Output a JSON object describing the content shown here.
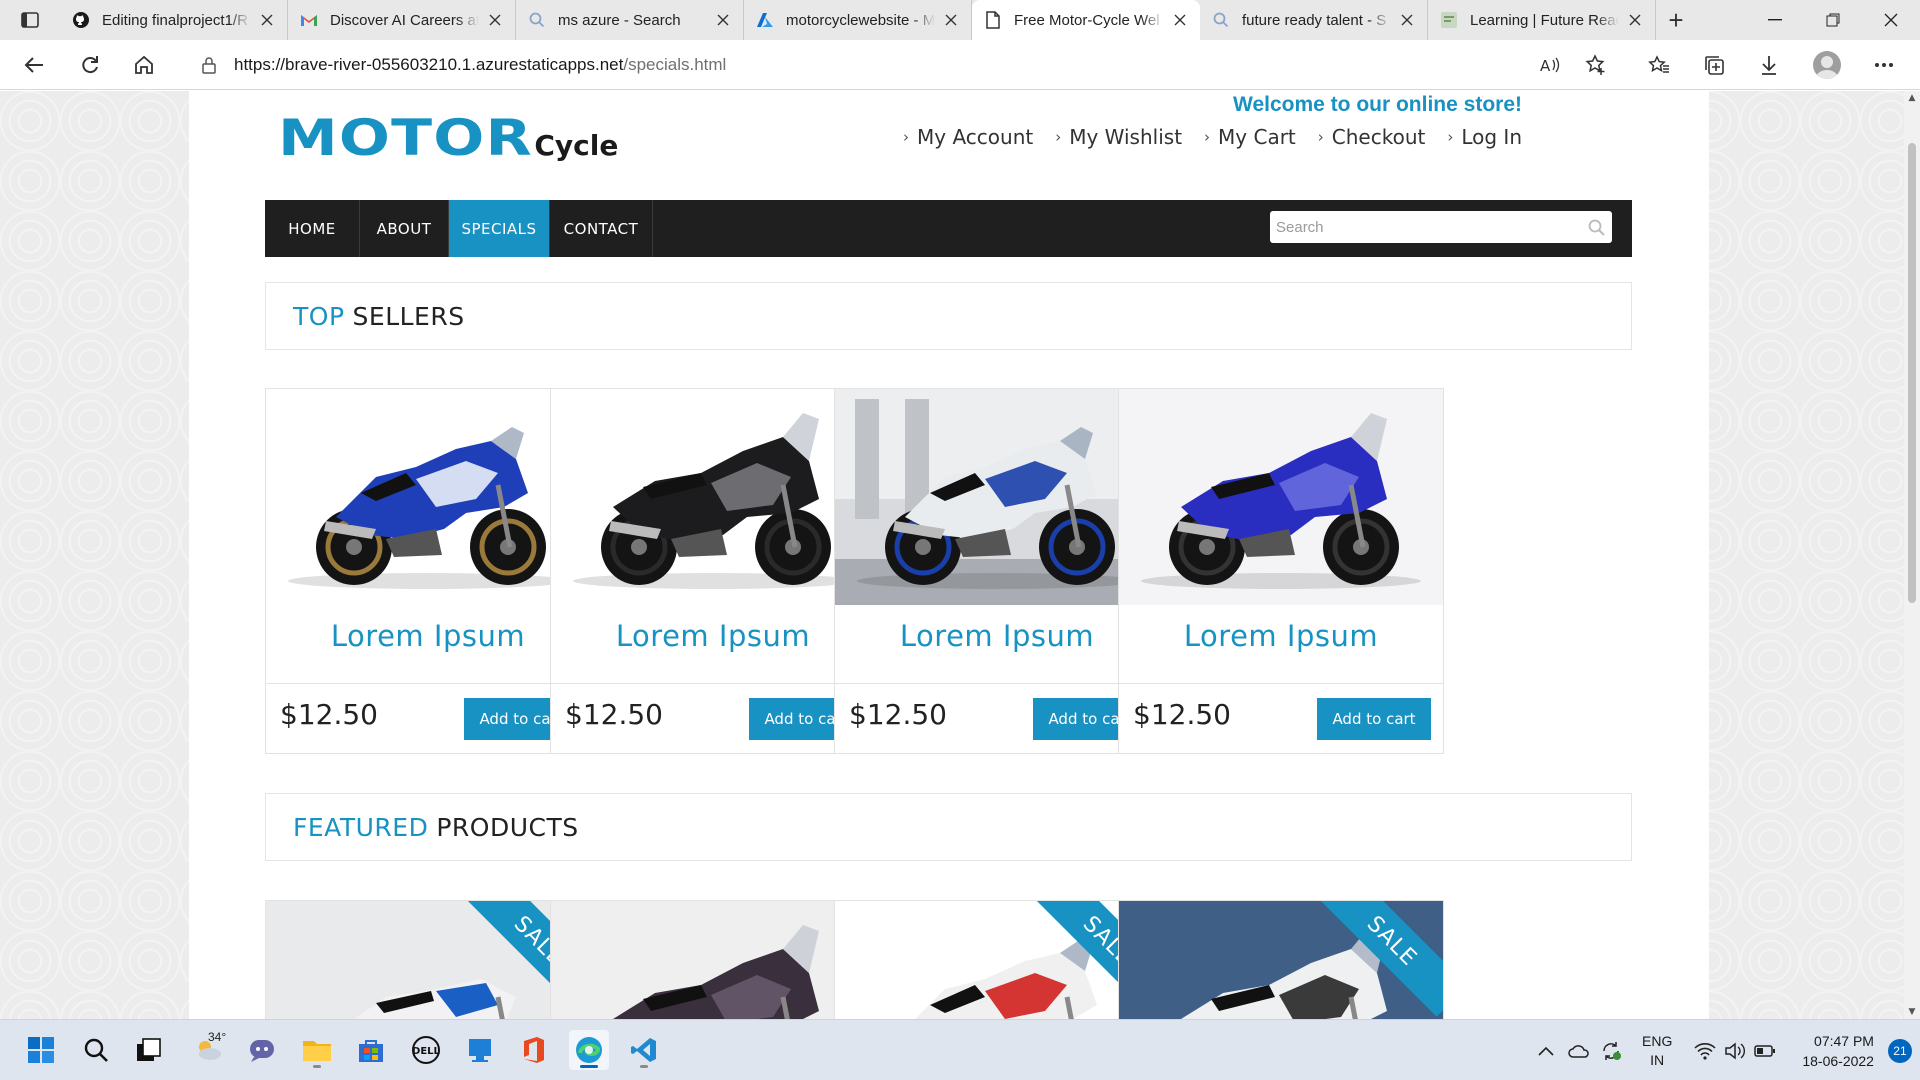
{
  "browser": {
    "tabs": [
      {
        "title": "Editing finalproject1/R",
        "icon": "github-icon"
      },
      {
        "title": "Discover AI Careers at",
        "icon": "gmail-icon"
      },
      {
        "title": "ms azure - Search",
        "icon": "search-icon"
      },
      {
        "title": "motorcyclewebsite - M",
        "icon": "azure-icon"
      },
      {
        "title": "Free Motor-Cycle Wel",
        "icon": "page-icon",
        "active": true
      },
      {
        "title": "future ready talent - S",
        "icon": "search-icon"
      },
      {
        "title": "Learning | Future Read",
        "icon": "learning-icon"
      }
    ],
    "url_host": "https://brave-river-055603210.1.azurestaticapps.net",
    "url_path": "/specials.html"
  },
  "site": {
    "logo_main": "MOTOR",
    "logo_sub": "Cycle",
    "welcome": "Welcome to our online store!",
    "top_links": [
      "My Account",
      "My Wishlist",
      "My Cart",
      "Checkout",
      "Log In"
    ],
    "nav": [
      {
        "label": "HOME"
      },
      {
        "label": "ABOUT"
      },
      {
        "label": "SPECIALS",
        "active": true
      },
      {
        "label": "CONTACT"
      }
    ],
    "search_placeholder": "Search",
    "top_sellers": {
      "accent": "TOP",
      "rest": "SELLERS",
      "products": [
        {
          "name": "Lorem Ipsum",
          "price": "$12.50",
          "button": "Add to cart",
          "image": "blue-sportbike-image"
        },
        {
          "name": "Lorem Ipsum",
          "price": "$12.50",
          "button": "Add to cart",
          "image": "black-touring-bike-image"
        },
        {
          "name": "Lorem Ipsum",
          "price": "$12.50",
          "button": "Add to cart",
          "image": "white-bmw-sportbike-image"
        },
        {
          "name": "Lorem Ipsum",
          "price": "$12.50",
          "button": "Add to cart",
          "image": "blue-touring-bike-image"
        }
      ]
    },
    "featured": {
      "accent": "FEATURED",
      "rest": "PRODUCTS",
      "products": [
        {
          "sale": "SALE",
          "image": "white-blue-naked-bike-image"
        },
        {
          "sale": "",
          "image": "dark-purple-sport-tourer-image"
        },
        {
          "sale": "SALE",
          "image": "red-white-sportbike-image"
        },
        {
          "sale": "SALE",
          "image": "white-bmw-tourer-image"
        }
      ]
    },
    "accent_color": "#1892c2",
    "nav_bg_color": "#1f1f1f"
  },
  "taskbar": {
    "weather_temp": "34°",
    "lang_line1": "ENG",
    "lang_line2": "IN",
    "time": "07:47 PM",
    "date": "18-06-2022",
    "notifications": "21"
  }
}
